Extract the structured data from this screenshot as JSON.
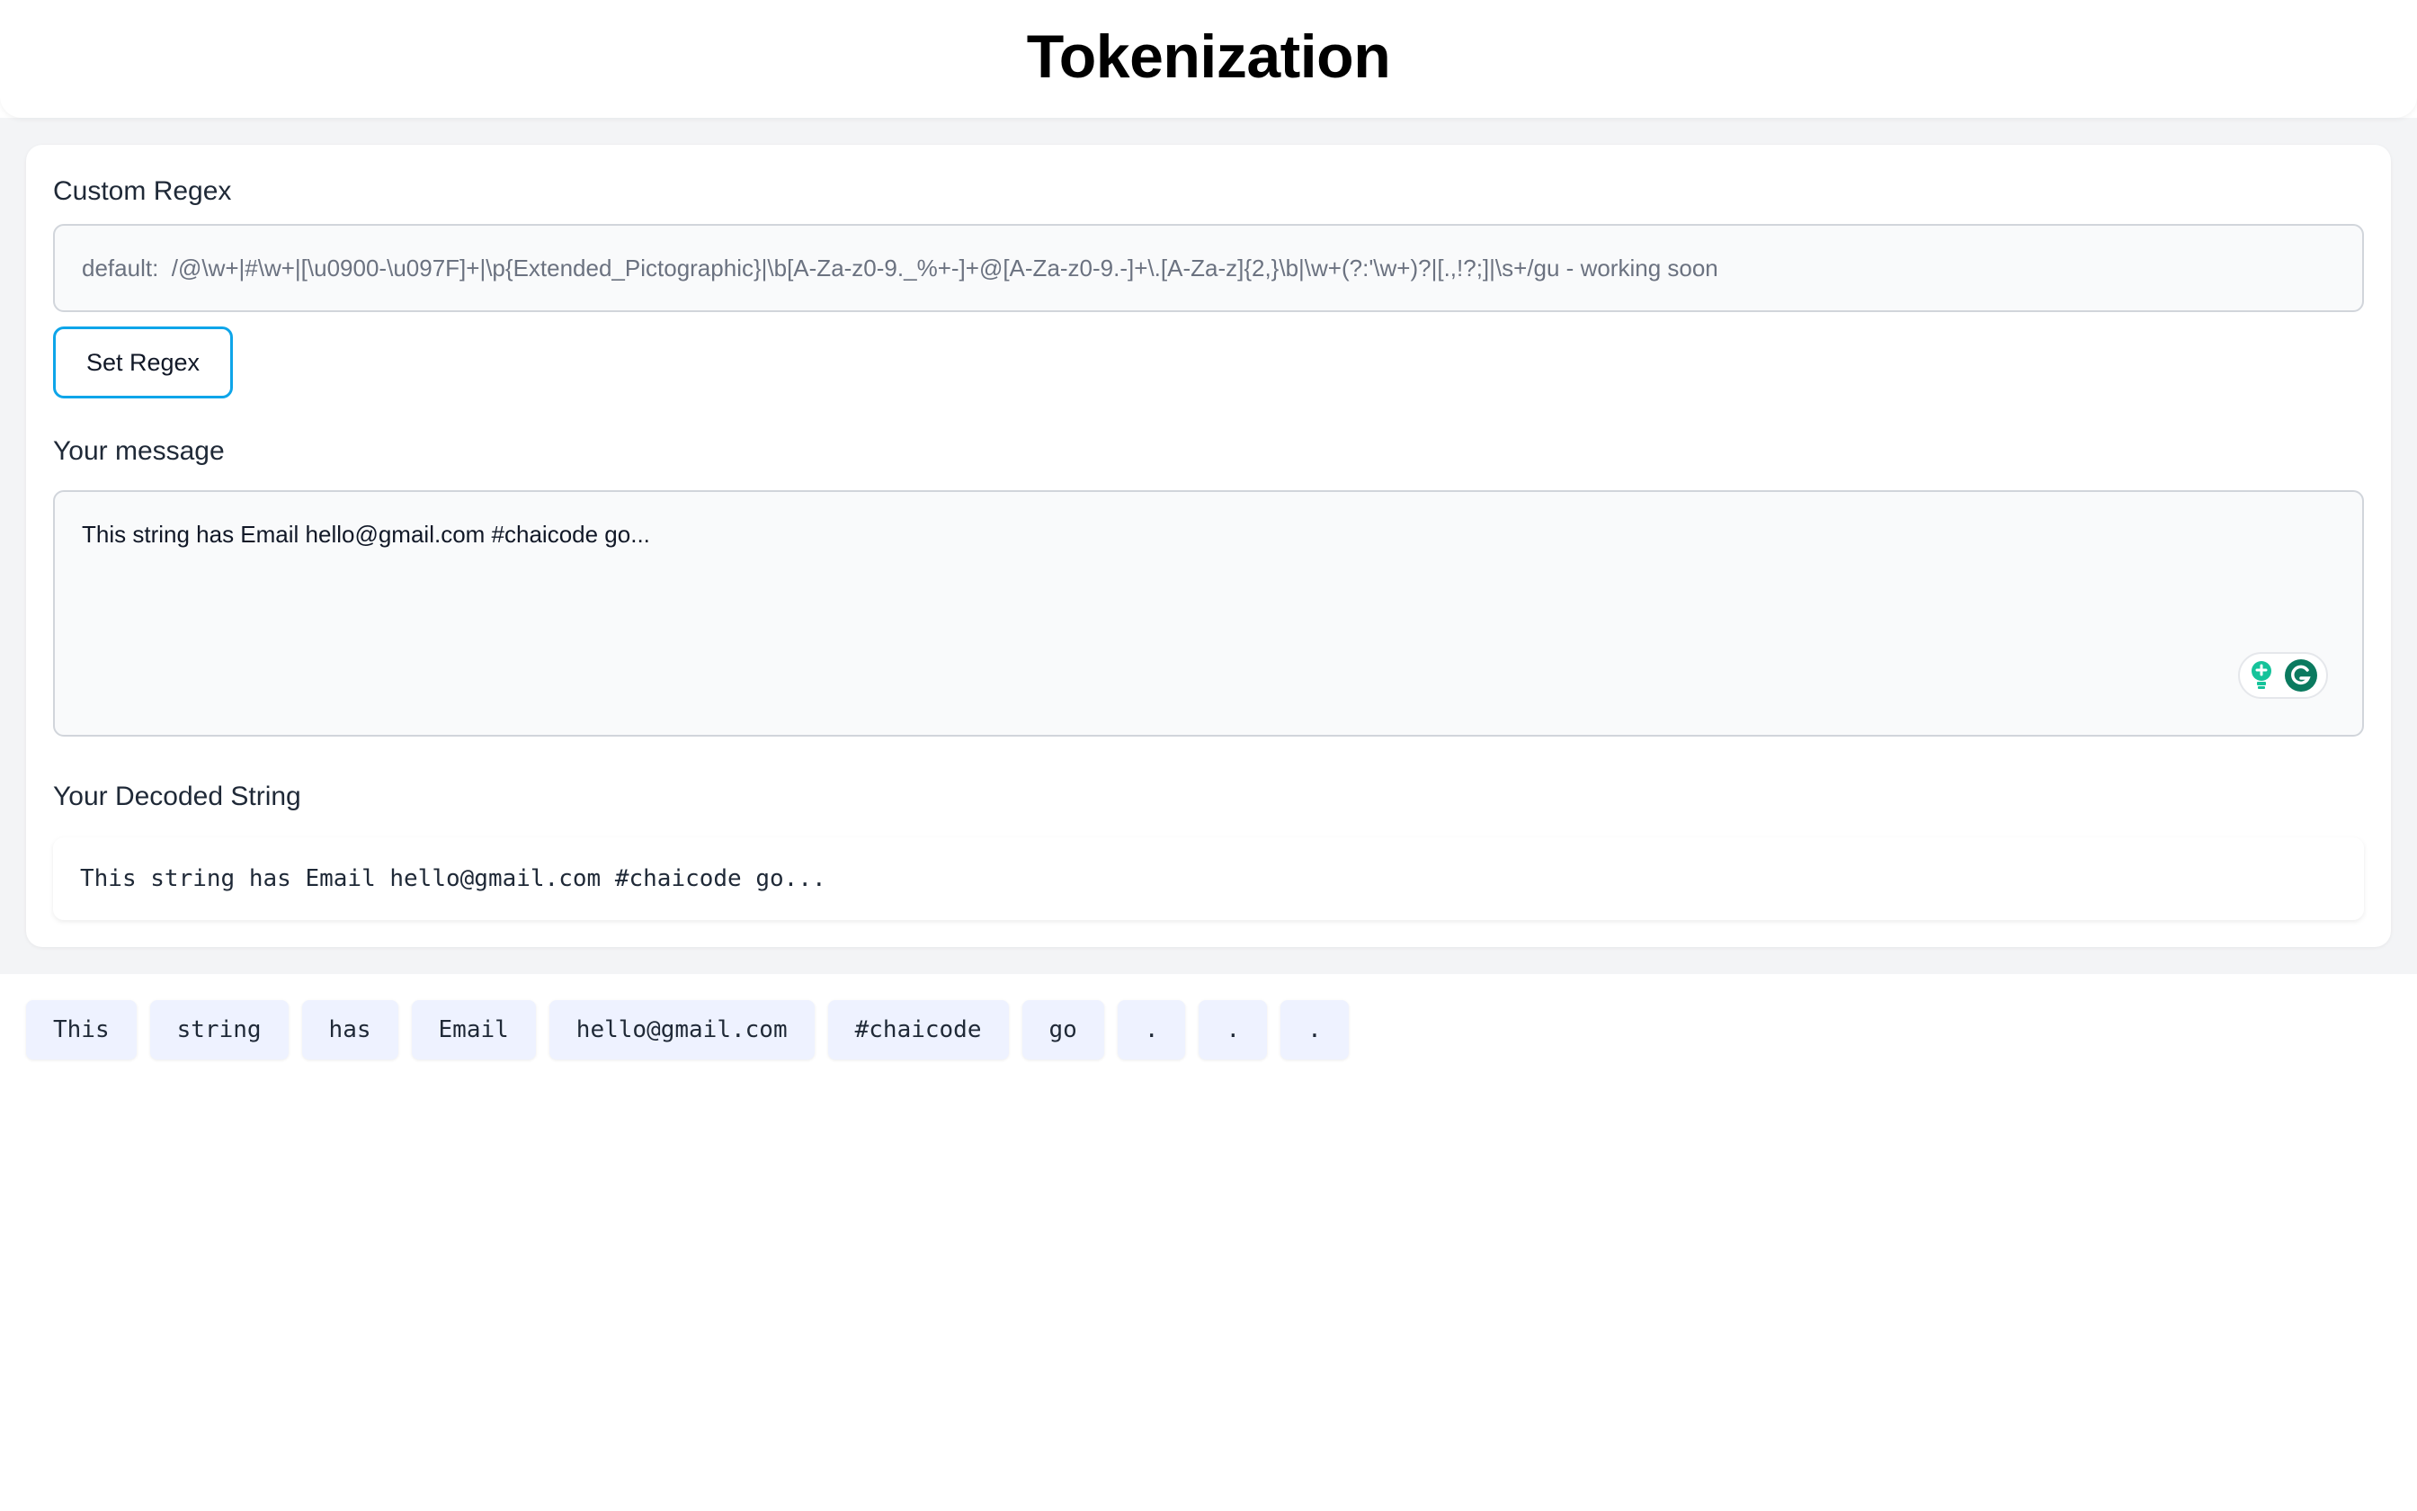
{
  "header": {
    "title": "Tokenization"
  },
  "regex": {
    "label": "Custom Regex",
    "placeholder": "default:  /@\\w+|#\\w+|[\\u0900-\\u097F]+|\\p{Extended_Pictographic}|\\b[A-Za-z0-9._%+-]+@[A-Za-z0-9.-]+\\.[A-Za-z]{2,}\\b|\\w+(?:'\\w+)?|[.,!?;]|\\s+/gu - working soon",
    "value": "",
    "button_label": "Set Regex"
  },
  "message": {
    "label": "Your message",
    "value": "This string has Email hello@gmail.com #chaicode go..."
  },
  "decoded": {
    "label": "Your Decoded String",
    "value": "This string has Email hello@gmail.com #chaicode go..."
  },
  "tokens": [
    "This",
    "string",
    "has",
    "Email",
    "hello@gmail.com",
    "#chaicode",
    "go",
    ".",
    ".",
    "."
  ],
  "icons": {
    "grammarly_bulb": "lightbulb-icon",
    "grammarly_logo": "grammarly-g-icon"
  },
  "colors": {
    "accent": "#0ea5e9",
    "token_bg": "#eef2ff",
    "grammarly": "#15c39a"
  }
}
